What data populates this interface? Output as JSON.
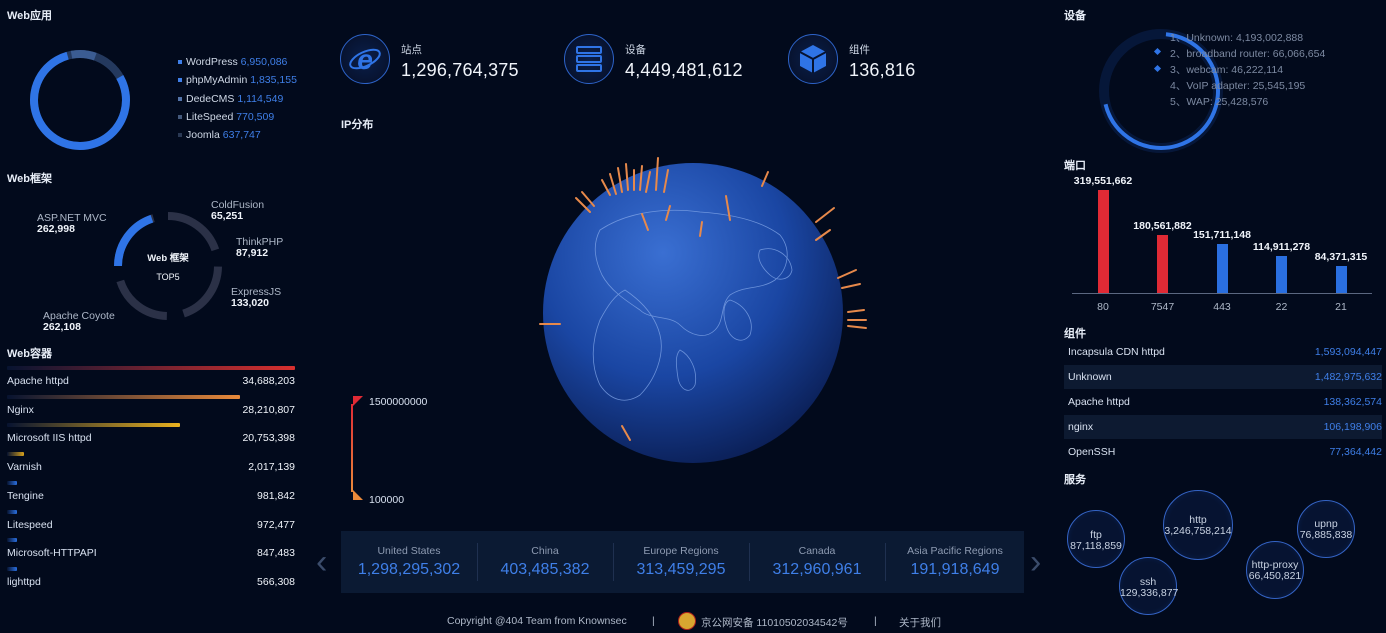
{
  "web_apps": {
    "title": "Web应用",
    "items": [
      {
        "name": "WordPress",
        "value": "6,950,086",
        "color": "#3f7fe8"
      },
      {
        "name": "phpMyAdmin",
        "value": "1,835,155",
        "color": "#3f7fe8"
      },
      {
        "name": "DedeCMS",
        "value": "1,114,549",
        "color": "#5373a8"
      },
      {
        "name": "LiteSpeed",
        "value": "770,509",
        "color": "#44597c"
      },
      {
        "name": "Joomla",
        "value": "637,747",
        "color": "#2a3954"
      }
    ]
  },
  "web_frameworks": {
    "title": "Web框架",
    "center_title": "Web 框架",
    "center_sub": "TOP5",
    "items": [
      {
        "name": "ASP.NET MVC",
        "value": "262,998"
      },
      {
        "name": "ColdFusion",
        "value": "65,251"
      },
      {
        "name": "ThinkPHP",
        "value": "87,912"
      },
      {
        "name": "ExpressJS",
        "value": "133,020"
      },
      {
        "name": "Apache Coyote",
        "value": "262,108"
      }
    ]
  },
  "web_containers": {
    "title": "Web容器",
    "items": [
      {
        "name": "Apache httpd",
        "value": "34,688,203",
        "share": 1.0,
        "color": "#d9302f"
      },
      {
        "name": "Nginx",
        "value": "28,210,807",
        "share": 0.81,
        "color": "#ea8a3a"
      },
      {
        "name": "Microsoft IIS httpd",
        "value": "20,753,398",
        "share": 0.6,
        "color": "#eab21f"
      },
      {
        "name": "Varnish",
        "value": "2,017,139",
        "share": 0.06,
        "color": "#d7a11c"
      },
      {
        "name": "Tengine",
        "value": "981,842",
        "share": 0.03,
        "color": "#2a6fe0"
      },
      {
        "name": "Litespeed",
        "value": "972,477",
        "share": 0.03,
        "color": "#2a6fe0"
      },
      {
        "name": "Microsoft-HTTPAPI",
        "value": "847,483",
        "share": 0.03,
        "color": "#2a6fe0"
      },
      {
        "name": "lighttpd",
        "value": "566,308",
        "share": 0.03,
        "color": "#2a6fe0"
      }
    ]
  },
  "stats": [
    {
      "label": "站点",
      "value": "1,296,764,375",
      "icon": "ie-icon"
    },
    {
      "label": "设备",
      "value": "4,449,481,612",
      "icon": "server-icon"
    },
    {
      "label": "组件",
      "value": "136,816",
      "icon": "cube-icon"
    }
  ],
  "ip_distribution": {
    "title": "IP分布",
    "scale_max": "1500000000",
    "scale_min": "100000"
  },
  "countries": [
    {
      "name": "United States",
      "value": "1,298,295,302"
    },
    {
      "name": "China",
      "value": "403,485,382"
    },
    {
      "name": "Europe Regions",
      "value": "313,459,295"
    },
    {
      "name": "Canada",
      "value": "312,960,961"
    },
    {
      "name": "Asia Pacific Regions",
      "value": "191,918,649"
    }
  ],
  "devices": {
    "title": "设备",
    "items": [
      "1、Unknown: 4,193,002,888",
      "2、broadband router: 66,066,654",
      "3、webcam: 46,222,114",
      "4、VoIP adapter: 25,545,195",
      "5、WAP: 25,428,576"
    ]
  },
  "ports": {
    "title": "端口"
  },
  "chart_data": {
    "type": "bar",
    "categories": [
      "80",
      "7547",
      "443",
      "22",
      "21"
    ],
    "values": [
      319551662,
      180561882,
      151711148,
      114911278,
      84371315
    ],
    "value_labels": [
      "319,551,662",
      "180,561,882",
      "151,711,148",
      "114,911,278",
      "84,371,315"
    ],
    "colors": [
      "#e02a35",
      "#e02a35",
      "#2a6fe0",
      "#2a6fe0",
      "#2a6fe0"
    ],
    "title": "端口",
    "ylim": [
      0,
      319551662
    ],
    "grid": false
  },
  "components": {
    "title": "组件",
    "items": [
      {
        "name": "Incapsula CDN httpd",
        "value": "1,593,094,447"
      },
      {
        "name": "Unknown",
        "value": "1,482,975,632"
      },
      {
        "name": "Apache httpd",
        "value": "138,362,574"
      },
      {
        "name": "nginx",
        "value": "106,198,906"
      },
      {
        "name": "OpenSSH",
        "value": "77,364,442"
      }
    ]
  },
  "services": {
    "title": "服务",
    "items": [
      {
        "name": "ftp",
        "value": "87,118,859"
      },
      {
        "name": "http",
        "value": "3,246,758,214"
      },
      {
        "name": "upnp",
        "value": "76,885,838"
      },
      {
        "name": "ssh",
        "value": "129,336,877"
      },
      {
        "name": "http-proxy",
        "value": "66,450,821"
      }
    ]
  },
  "footer": {
    "copyright": "Copyright @404 Team from Knownsec",
    "sep": "|",
    "icp": "京公网安备 11010502034542号",
    "about": "关于我们"
  },
  "nav": {
    "prev": "‹",
    "next": "›"
  },
  "colors": {
    "bg": "#020a1c",
    "accent": "#3f7fe8",
    "red": "#e02a35",
    "orange": "#ea8a3a"
  }
}
